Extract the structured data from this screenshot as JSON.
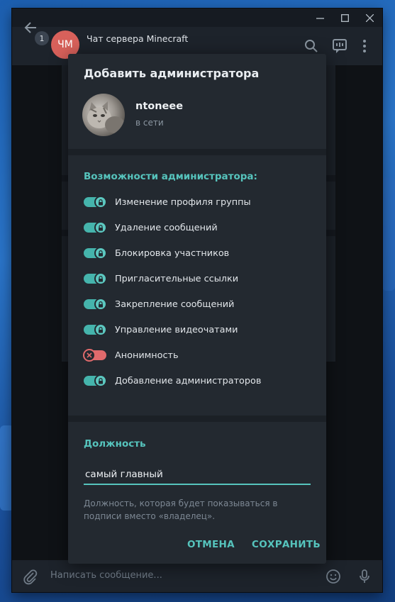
{
  "window": {
    "chat_title": "Чат сервера Minecraft",
    "chat_avatar_initials": "ЧМ",
    "unread_badge": "1",
    "composer_placeholder": "Написать сообщение..."
  },
  "dialog": {
    "title": "Добавить администратора",
    "user": {
      "name": "ntoneee",
      "status": "в сети"
    },
    "permissions_title": "Возможности администратора:",
    "permissions": [
      {
        "label": "Изменение профиля группы",
        "enabled": true
      },
      {
        "label": "Удаление сообщений",
        "enabled": true
      },
      {
        "label": "Блокировка участников",
        "enabled": true
      },
      {
        "label": "Пригласительные ссылки",
        "enabled": true
      },
      {
        "label": "Закрепление сообщений",
        "enabled": true
      },
      {
        "label": "Управление видеочатами",
        "enabled": true
      },
      {
        "label": "Анонимность",
        "enabled": false
      },
      {
        "label": "Добавление администраторов",
        "enabled": true
      }
    ],
    "rank_label": "Должность",
    "rank_value": "самый главный",
    "rank_hint": "Должность, которая будет показываться в подписи вместо «владелец».",
    "cancel_label": "ОТМЕНА",
    "save_label": "СОХРАНИТЬ"
  },
  "colors": {
    "accent": "#56c4bd",
    "toggle_on": "#45b4ac",
    "toggle_off": "#e06a6c",
    "dialog_bg": "#232930"
  }
}
